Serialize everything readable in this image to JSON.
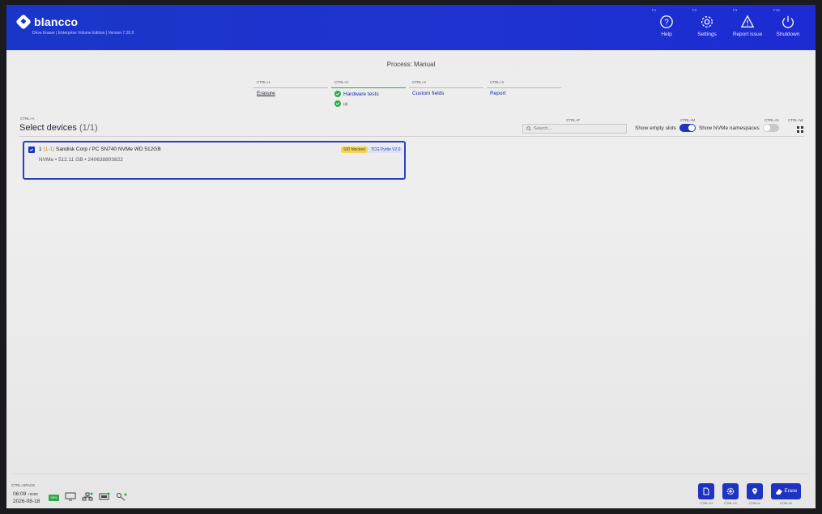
{
  "header": {
    "brand": "blancco",
    "subtitle": "Drive Eraser | Enterprise Volume Edition | Version 7.20.0",
    "actions": [
      {
        "key": "F1",
        "label": "Help",
        "icon": "help-icon"
      },
      {
        "key": "F2",
        "label": "Settings",
        "icon": "gear-icon"
      },
      {
        "key": "F3",
        "label": "Report issue",
        "icon": "warning-icon"
      },
      {
        "key": "F10",
        "label": "Shutdown",
        "icon": "power-icon"
      }
    ]
  },
  "process": {
    "title": "Process: Manual",
    "steps": [
      {
        "key": "CTRL+1",
        "label": "Erasure"
      },
      {
        "key": "CTRL+2",
        "label": "Hardware tests",
        "sub": "(2)"
      },
      {
        "key": "CTRL+3",
        "label": "Custom fields"
      },
      {
        "key": "CTRL+4",
        "label": "Report"
      }
    ]
  },
  "select_devices": {
    "key": "CTRL+A",
    "title": "Select devices",
    "count": "(1/1)",
    "search_key": "CTRL+F",
    "search_placeholder": "Search...",
    "show_empty_slots": "Show empty slots",
    "show_empty_slots_key": "CTRL+M",
    "show_nvme_namespaces": "Show NVMe namespaces",
    "nvme_key": "CTRL+N",
    "grid_key": "CTRL+W"
  },
  "device": {
    "index": "1",
    "slot": "(1-1)",
    "name": "Sandisk Corp / PC SN740 NVMe WD 512GB",
    "meta": "NVMe • 512.11 GB • 240638803822",
    "badges": [
      "SID blocked",
      "TCG Pyrite V2.0"
    ]
  },
  "footer": {
    "key": "CTRL+SPACE",
    "time": "06:09",
    "tz": "+0000",
    "date": "2026-08-18",
    "battery": "99%",
    "actions": [
      {
        "key": "CTRL+H",
        "icon": "report-icon"
      },
      {
        "key": "CTRL+G",
        "icon": "gear-icon"
      },
      {
        "key": "CTRL+L",
        "icon": "location-icon"
      },
      {
        "key": "CTRL+E",
        "icon": "eraser-icon",
        "label": "Erase"
      }
    ]
  },
  "colors": {
    "brand_blue": "#1e33d0",
    "accent_green": "#2fa84a",
    "badge_yellow": "#f5d64d"
  }
}
